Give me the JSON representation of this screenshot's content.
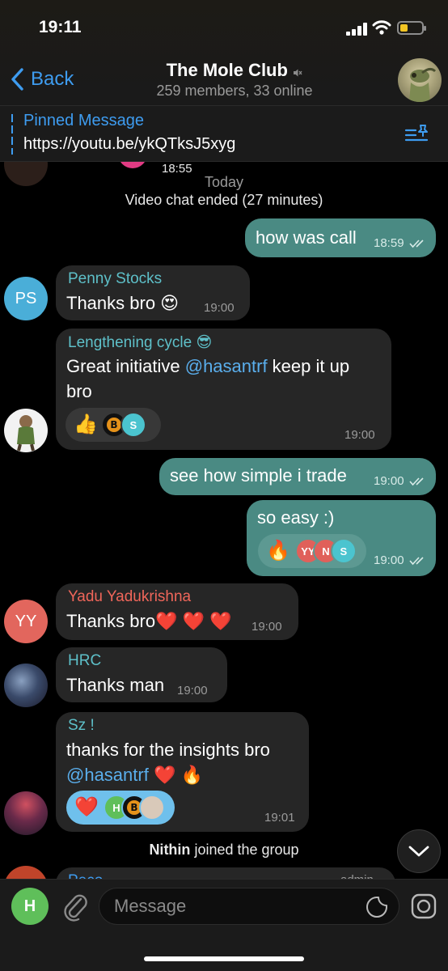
{
  "status_bar": {
    "time": "19:11",
    "battery_color": "#f2c523"
  },
  "header": {
    "back_label": "Back",
    "title": "The Mole Club",
    "subtitle": "259 members, 33 online",
    "muted": true
  },
  "pinned": {
    "label": "Pinned Message",
    "text": "https://youtu.be/ykQTksJ5xyg"
  },
  "chat": {
    "cut_top_time": "18:55",
    "date_separator": "Today",
    "service_video": "Video chat ended (27 minutes)",
    "messages": {
      "m1": {
        "text": "how was call",
        "time": "18:59"
      },
      "m2": {
        "sender": "Penny Stocks",
        "initials": "PS",
        "text": "Thanks bro 😍",
        "time": "19:00",
        "avatar_color": "#4aaed8"
      },
      "m3": {
        "sender": "Lengthening cycle 😎",
        "text_a": "Great initiative ",
        "mention": "@hasantrf",
        "text_b": " keep it up",
        "text_c": "bro",
        "time": "19:00",
        "reactions": [
          {
            "emoji": "👍"
          },
          {
            "icon": "bitcoin"
          },
          {
            "initials": "S",
            "color": "#4bc4cf"
          }
        ]
      },
      "m4": {
        "text": "see how simple i trade",
        "time": "19:00"
      },
      "m5": {
        "text": "so easy :)",
        "time": "19:00",
        "reactions": [
          {
            "emoji": "🔥"
          },
          {
            "initials": "YY",
            "color": "#e0605a"
          },
          {
            "initials": "N",
            "color": "#e0605a"
          },
          {
            "initials": "S",
            "color": "#4bc4cf"
          }
        ]
      },
      "m6": {
        "sender": "Yadu Yadukrishna",
        "initials": "YY",
        "text": "Thanks bro❤️ ❤️ ❤️",
        "time": "19:00",
        "avatar_color": "#e2665d"
      },
      "m7": {
        "sender": "HRC",
        "text": "Thanks man",
        "time": "19:00"
      },
      "m8": {
        "sender": "Sz !",
        "text_a": "thanks for the insights bro",
        "mention": "@hasantrf",
        "text_b": " ❤️ 🔥",
        "time": "19:01",
        "reactions": [
          {
            "emoji": "❤️"
          },
          {
            "initials": "H",
            "color": "#5fbf5a"
          },
          {
            "icon": "bitcoin"
          },
          {
            "icon": "photo"
          }
        ]
      }
    },
    "service_join_name": "Nithin",
    "service_join_text": " joined the group",
    "cut_bottom_sender": "Peco",
    "cut_bottom_role": "admin"
  },
  "input": {
    "placeholder": "Message",
    "my_initial": "H",
    "my_color": "#5fbf5a"
  },
  "colors": {
    "accent": "#3e9cf0",
    "outgoing_bubble": "#4a8a83",
    "incoming_bubble": "#262626",
    "name_teal": "#5ec0c9",
    "name_red": "#f0665a",
    "mention": "#5aaeec"
  }
}
